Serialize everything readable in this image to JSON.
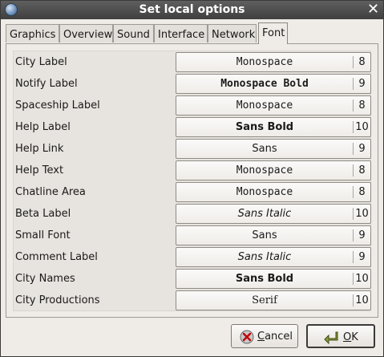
{
  "window": {
    "title": "Set local options"
  },
  "tabs": [
    {
      "label": "Graphics",
      "active": false
    },
    {
      "label": "Overview",
      "active": false
    },
    {
      "label": "Sound",
      "active": false
    },
    {
      "label": "Interface",
      "active": false
    },
    {
      "label": "Network",
      "active": false
    },
    {
      "label": "Font",
      "active": true
    }
  ],
  "fonts": [
    {
      "label": "City Label",
      "font": "Monospace",
      "size": "8",
      "style": "mono"
    },
    {
      "label": "Notify Label",
      "font": "Monospace Bold",
      "size": "9",
      "style": "monob"
    },
    {
      "label": "Spaceship Label",
      "font": "Monospace",
      "size": "8",
      "style": "mono"
    },
    {
      "label": "Help Label",
      "font": "Sans Bold",
      "size": "10",
      "style": "sansb"
    },
    {
      "label": "Help Link",
      "font": "Sans",
      "size": "9",
      "style": "sans"
    },
    {
      "label": "Help Text",
      "font": "Monospace",
      "size": "8",
      "style": "mono"
    },
    {
      "label": "Chatline Area",
      "font": "Monospace",
      "size": "8",
      "style": "mono"
    },
    {
      "label": "Beta Label",
      "font": "Sans Italic",
      "size": "10",
      "style": "sansi"
    },
    {
      "label": "Small Font",
      "font": "Sans",
      "size": "9",
      "style": "sans"
    },
    {
      "label": "Comment Label",
      "font": "Sans Italic",
      "size": "9",
      "style": "sansi"
    },
    {
      "label": "City Names",
      "font": "Sans Bold",
      "size": "10",
      "style": "sansb"
    },
    {
      "label": "City Productions",
      "font": "Serif",
      "size": "10",
      "style": "serif"
    }
  ],
  "buttons": {
    "cancel": "Cancel",
    "ok": "OK"
  }
}
